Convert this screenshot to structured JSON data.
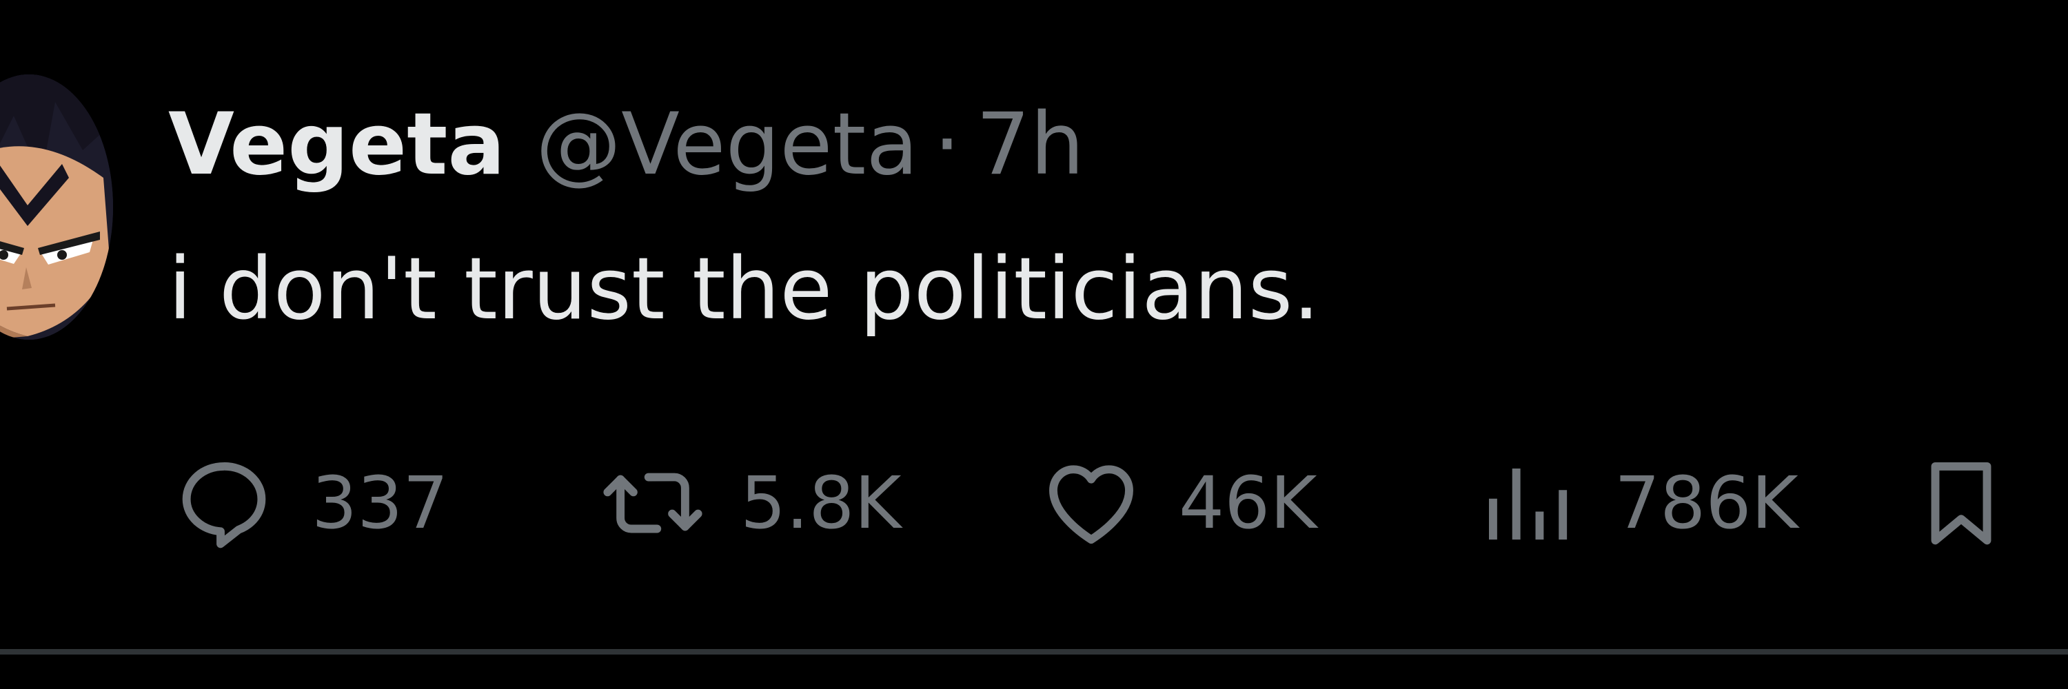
{
  "user": {
    "display_name": "Vegeta",
    "handle": "@Vegeta",
    "separator": "·",
    "time": "7h",
    "avatar_icon": "anime-character-avatar"
  },
  "tweet": {
    "text": "i don't trust the politicians."
  },
  "actions": {
    "replies": "337",
    "reposts": "5.8K",
    "likes": "46K",
    "views": "786K"
  },
  "colors": {
    "background": "#000000",
    "primary_text": "#e7e9ea",
    "secondary_text": "#71767b",
    "divider": "#2f3336"
  }
}
